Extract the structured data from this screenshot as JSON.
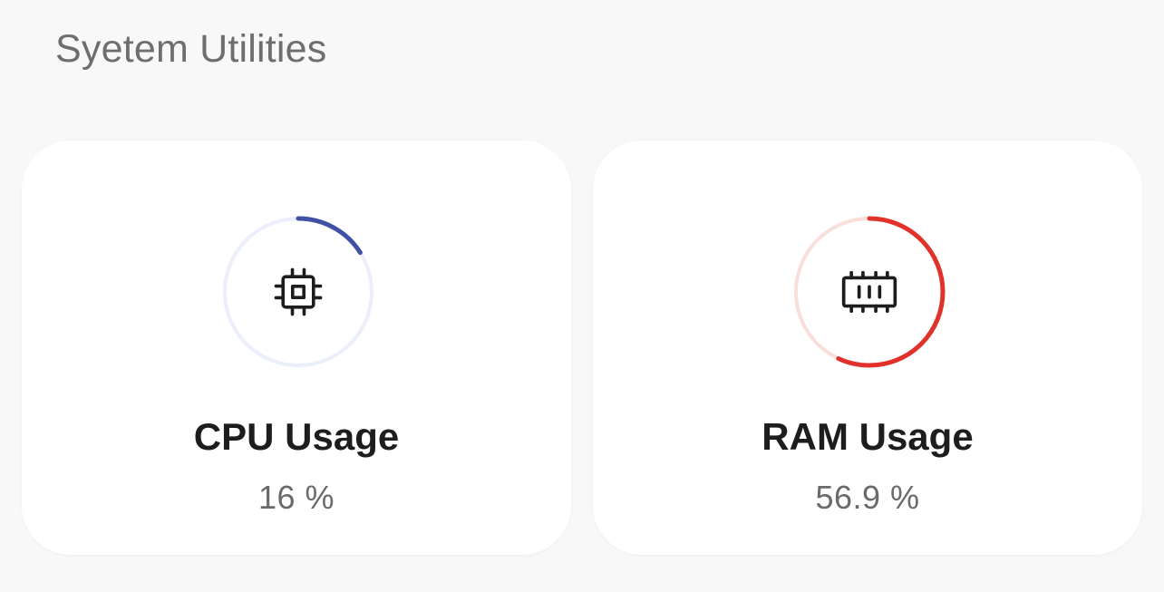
{
  "header": {
    "title": "Syetem Utilities"
  },
  "cards": [
    {
      "id": "cpu",
      "label": "CPU Usage",
      "value_text": "16 %",
      "usage_fraction": 0.16,
      "icon": "cpu-chip-icon",
      "color": "#3f51a5",
      "track_color": "#ebeefb"
    },
    {
      "id": "ram",
      "label": "RAM Usage",
      "value_text": "56.9 %",
      "usage_fraction": 0.569,
      "icon": "memory-module-icon",
      "color": "#e0322a",
      "track_color": "#f9dfdc"
    }
  ]
}
